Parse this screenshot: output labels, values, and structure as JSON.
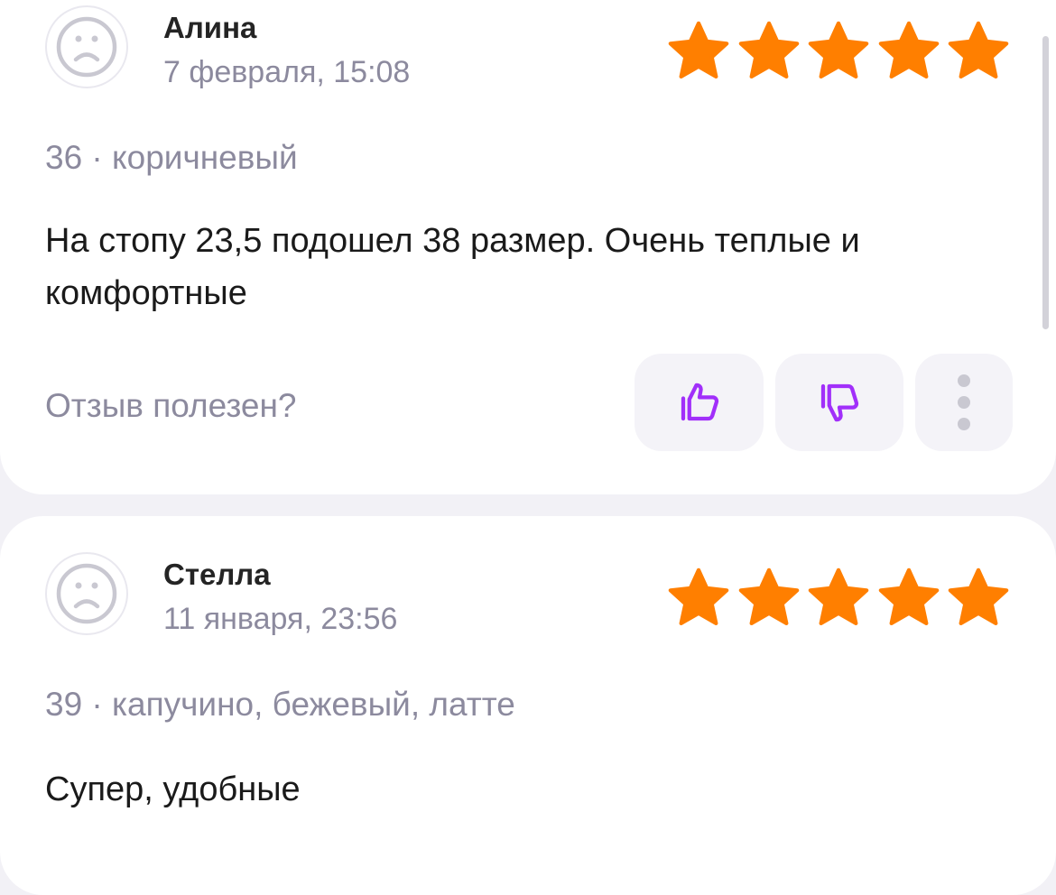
{
  "colors": {
    "star": "#ff7f00",
    "accent": "#a12ffa",
    "muted_text": "#8c8a9e",
    "button_bg": "#f4f3f8",
    "avatar_face": "#c9c8d1"
  },
  "reviews": [
    {
      "author": "Алина",
      "date": "7 февраля, 15:08",
      "rating": 5,
      "rating_max": 5,
      "variant": "36 · коричневый",
      "text": "На стопу 23,5 подошел 38 размер. Очень теплые и комфортные",
      "helpful_prompt": "Отзыв полезен?",
      "icons": {
        "avatar": "sad-face-icon",
        "like": "thumbs-up-icon",
        "dislike": "thumbs-down-icon",
        "more": "more-vertical-icon"
      }
    },
    {
      "author": "Стелла",
      "date": "11 января, 23:56",
      "rating": 5,
      "rating_max": 5,
      "variant": "39 · капучино, бежевый, латте",
      "text": "Супер, удобные",
      "icons": {
        "avatar": "sad-face-icon"
      }
    }
  ]
}
